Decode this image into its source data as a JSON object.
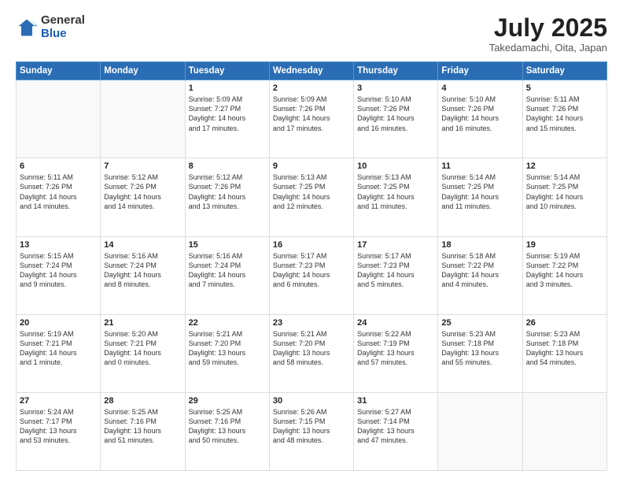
{
  "logo": {
    "general": "General",
    "blue": "Blue"
  },
  "header": {
    "title": "July 2025",
    "subtitle": "Takedamachi, Oita, Japan"
  },
  "weekdays": [
    "Sunday",
    "Monday",
    "Tuesday",
    "Wednesday",
    "Thursday",
    "Friday",
    "Saturday"
  ],
  "weeks": [
    [
      {
        "day": "",
        "info": ""
      },
      {
        "day": "",
        "info": ""
      },
      {
        "day": "1",
        "info": "Sunrise: 5:09 AM\nSunset: 7:27 PM\nDaylight: 14 hours\nand 17 minutes."
      },
      {
        "day": "2",
        "info": "Sunrise: 5:09 AM\nSunset: 7:26 PM\nDaylight: 14 hours\nand 17 minutes."
      },
      {
        "day": "3",
        "info": "Sunrise: 5:10 AM\nSunset: 7:26 PM\nDaylight: 14 hours\nand 16 minutes."
      },
      {
        "day": "4",
        "info": "Sunrise: 5:10 AM\nSunset: 7:26 PM\nDaylight: 14 hours\nand 16 minutes."
      },
      {
        "day": "5",
        "info": "Sunrise: 5:11 AM\nSunset: 7:26 PM\nDaylight: 14 hours\nand 15 minutes."
      }
    ],
    [
      {
        "day": "6",
        "info": "Sunrise: 5:11 AM\nSunset: 7:26 PM\nDaylight: 14 hours\nand 14 minutes."
      },
      {
        "day": "7",
        "info": "Sunrise: 5:12 AM\nSunset: 7:26 PM\nDaylight: 14 hours\nand 14 minutes."
      },
      {
        "day": "8",
        "info": "Sunrise: 5:12 AM\nSunset: 7:26 PM\nDaylight: 14 hours\nand 13 minutes."
      },
      {
        "day": "9",
        "info": "Sunrise: 5:13 AM\nSunset: 7:25 PM\nDaylight: 14 hours\nand 12 minutes."
      },
      {
        "day": "10",
        "info": "Sunrise: 5:13 AM\nSunset: 7:25 PM\nDaylight: 14 hours\nand 11 minutes."
      },
      {
        "day": "11",
        "info": "Sunrise: 5:14 AM\nSunset: 7:25 PM\nDaylight: 14 hours\nand 11 minutes."
      },
      {
        "day": "12",
        "info": "Sunrise: 5:14 AM\nSunset: 7:25 PM\nDaylight: 14 hours\nand 10 minutes."
      }
    ],
    [
      {
        "day": "13",
        "info": "Sunrise: 5:15 AM\nSunset: 7:24 PM\nDaylight: 14 hours\nand 9 minutes."
      },
      {
        "day": "14",
        "info": "Sunrise: 5:16 AM\nSunset: 7:24 PM\nDaylight: 14 hours\nand 8 minutes."
      },
      {
        "day": "15",
        "info": "Sunrise: 5:16 AM\nSunset: 7:24 PM\nDaylight: 14 hours\nand 7 minutes."
      },
      {
        "day": "16",
        "info": "Sunrise: 5:17 AM\nSunset: 7:23 PM\nDaylight: 14 hours\nand 6 minutes."
      },
      {
        "day": "17",
        "info": "Sunrise: 5:17 AM\nSunset: 7:23 PM\nDaylight: 14 hours\nand 5 minutes."
      },
      {
        "day": "18",
        "info": "Sunrise: 5:18 AM\nSunset: 7:22 PM\nDaylight: 14 hours\nand 4 minutes."
      },
      {
        "day": "19",
        "info": "Sunrise: 5:19 AM\nSunset: 7:22 PM\nDaylight: 14 hours\nand 3 minutes."
      }
    ],
    [
      {
        "day": "20",
        "info": "Sunrise: 5:19 AM\nSunset: 7:21 PM\nDaylight: 14 hours\nand 1 minute."
      },
      {
        "day": "21",
        "info": "Sunrise: 5:20 AM\nSunset: 7:21 PM\nDaylight: 14 hours\nand 0 minutes."
      },
      {
        "day": "22",
        "info": "Sunrise: 5:21 AM\nSunset: 7:20 PM\nDaylight: 13 hours\nand 59 minutes."
      },
      {
        "day": "23",
        "info": "Sunrise: 5:21 AM\nSunset: 7:20 PM\nDaylight: 13 hours\nand 58 minutes."
      },
      {
        "day": "24",
        "info": "Sunrise: 5:22 AM\nSunset: 7:19 PM\nDaylight: 13 hours\nand 57 minutes."
      },
      {
        "day": "25",
        "info": "Sunrise: 5:23 AM\nSunset: 7:18 PM\nDaylight: 13 hours\nand 55 minutes."
      },
      {
        "day": "26",
        "info": "Sunrise: 5:23 AM\nSunset: 7:18 PM\nDaylight: 13 hours\nand 54 minutes."
      }
    ],
    [
      {
        "day": "27",
        "info": "Sunrise: 5:24 AM\nSunset: 7:17 PM\nDaylight: 13 hours\nand 53 minutes."
      },
      {
        "day": "28",
        "info": "Sunrise: 5:25 AM\nSunset: 7:16 PM\nDaylight: 13 hours\nand 51 minutes."
      },
      {
        "day": "29",
        "info": "Sunrise: 5:25 AM\nSunset: 7:16 PM\nDaylight: 13 hours\nand 50 minutes."
      },
      {
        "day": "30",
        "info": "Sunrise: 5:26 AM\nSunset: 7:15 PM\nDaylight: 13 hours\nand 48 minutes."
      },
      {
        "day": "31",
        "info": "Sunrise: 5:27 AM\nSunset: 7:14 PM\nDaylight: 13 hours\nand 47 minutes."
      },
      {
        "day": "",
        "info": ""
      },
      {
        "day": "",
        "info": ""
      }
    ]
  ]
}
